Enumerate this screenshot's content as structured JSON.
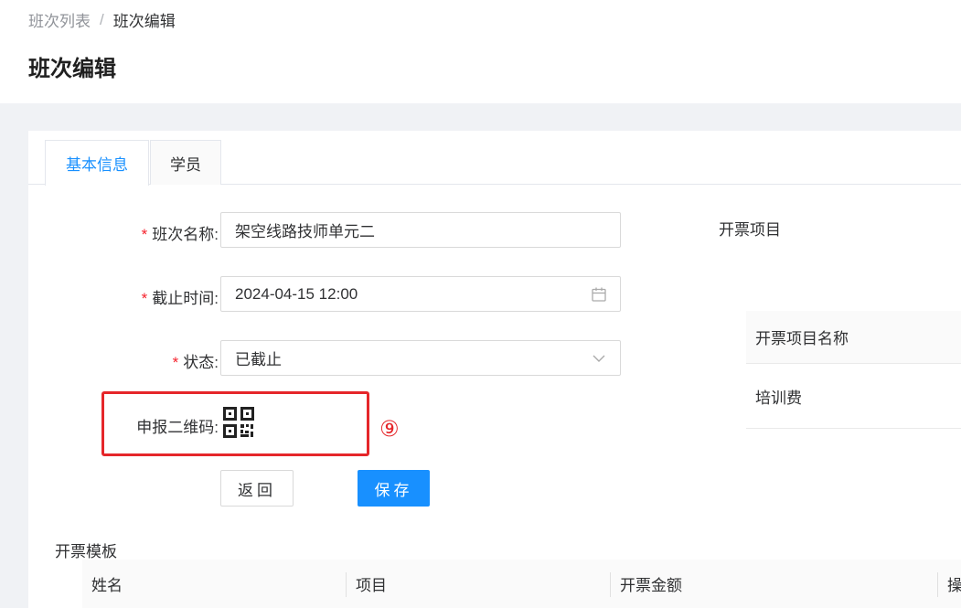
{
  "breadcrumb": {
    "parent": "班次列表",
    "separator": "/",
    "current": "班次编辑"
  },
  "page_title": "班次编辑",
  "tabs": [
    {
      "label": "基本信息",
      "active": true
    },
    {
      "label": "学员",
      "active": false
    }
  ],
  "form": {
    "required_mark": "*",
    "name_label": "班次名称:",
    "name_value": "架空线路技师单元二",
    "deadline_label": "截止时间:",
    "deadline_value": "2024-04-15 12:00",
    "status_label": "状态:",
    "status_value": "已截止",
    "qrcode_label": "申报二维码:"
  },
  "annotation_marker": "⑨",
  "buttons": {
    "back": "返回",
    "save": "保存"
  },
  "invoice_items": {
    "title": "开票项目",
    "header": "开票项目名称",
    "rows": [
      "培训费"
    ]
  },
  "invoice_template": {
    "title": "开票模板",
    "columns": [
      "姓名",
      "项目",
      "开票金额",
      "操"
    ]
  },
  "colors": {
    "primary": "#1890ff",
    "required": "#f5222d",
    "highlight_box": "#e5262a"
  },
  "icons": {
    "deadline_input": "calendar-icon",
    "status_select": "chevron-down-icon",
    "qrcode": "qrcode-icon"
  }
}
